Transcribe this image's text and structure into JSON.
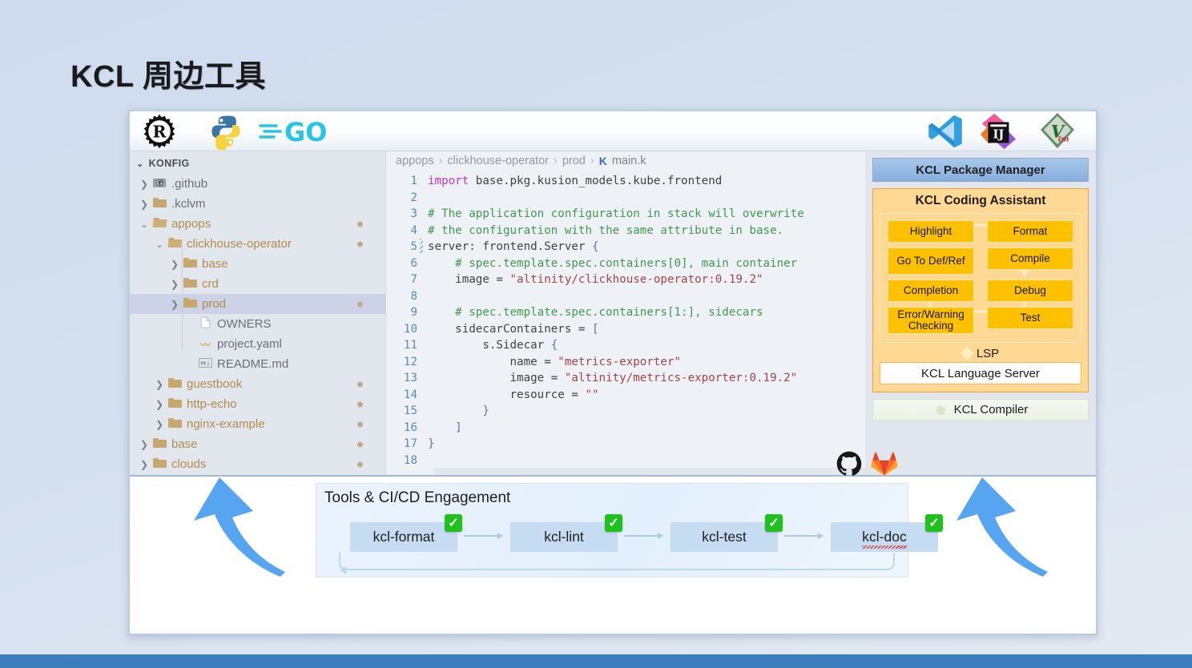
{
  "slide": {
    "title": "KCL 周边工具",
    "background_color": "#cfdcee",
    "accent_bar_color": "#3a7ebf"
  },
  "toolbar": {
    "left_logos": [
      {
        "name": "rust-logo",
        "label": "Rust"
      },
      {
        "name": "python-logo",
        "label": "Python"
      },
      {
        "name": "go-logo",
        "label": "GO"
      }
    ],
    "right_logos": [
      {
        "name": "vscode-logo",
        "label": "Visual Studio Code"
      },
      {
        "name": "intellij-idea-logo",
        "label": "IJ"
      },
      {
        "name": "vim-logo",
        "label": "Vim"
      }
    ]
  },
  "explorer": {
    "root_label": "KONFIG",
    "items": [
      {
        "label": ".github",
        "indent": 0,
        "icon": "github-folder-icon",
        "chevron": ">",
        "modified": false,
        "dot": false,
        "selected": false
      },
      {
        "label": ".kclvm",
        "indent": 0,
        "icon": "folder-icon",
        "chevron": ">",
        "modified": false,
        "dot": false,
        "selected": false
      },
      {
        "label": "appops",
        "indent": 0,
        "icon": "folder-open-icon",
        "chevron": "v",
        "modified": true,
        "dot": true,
        "selected": false
      },
      {
        "label": "clickhouse-operator",
        "indent": 1,
        "icon": "folder-open-icon",
        "chevron": "v",
        "modified": true,
        "dot": true,
        "selected": false
      },
      {
        "label": "base",
        "indent": 2,
        "icon": "folder-icon",
        "chevron": ">",
        "modified": true,
        "dot": false,
        "selected": false
      },
      {
        "label": "crd",
        "indent": 2,
        "icon": "folder-icon",
        "chevron": ">",
        "modified": true,
        "dot": false,
        "selected": false
      },
      {
        "label": "prod",
        "indent": 2,
        "icon": "folder-icon",
        "chevron": ">",
        "modified": true,
        "dot": true,
        "selected": true
      },
      {
        "label": "OWNERS",
        "indent": 3,
        "icon": "file-icon",
        "chevron": "",
        "modified": false,
        "dot": false,
        "selected": false
      },
      {
        "label": "project.yaml",
        "indent": 3,
        "icon": "yaml-file-icon",
        "chevron": "",
        "modified": false,
        "dot": false,
        "selected": false
      },
      {
        "label": "README.md",
        "indent": 3,
        "icon": "markdown-file-icon",
        "chevron": "",
        "modified": false,
        "dot": false,
        "selected": false
      },
      {
        "label": "guestbook",
        "indent": 1,
        "icon": "folder-icon",
        "chevron": ">",
        "modified": true,
        "dot": true,
        "selected": false
      },
      {
        "label": "http-echo",
        "indent": 1,
        "icon": "folder-icon",
        "chevron": ">",
        "modified": true,
        "dot": true,
        "selected": false
      },
      {
        "label": "nginx-example",
        "indent": 1,
        "icon": "folder-icon",
        "chevron": ">",
        "modified": true,
        "dot": true,
        "selected": false
      },
      {
        "label": "base",
        "indent": 0,
        "icon": "folder-icon",
        "chevron": ">",
        "modified": true,
        "dot": true,
        "selected": false
      },
      {
        "label": "clouds",
        "indent": 0,
        "icon": "folder-icon",
        "chevron": ">",
        "modified": true,
        "dot": true,
        "selected": false
      }
    ]
  },
  "editor": {
    "breadcrumb": [
      "appops",
      "clickhouse-operator",
      "prod"
    ],
    "file_icon_label": "K",
    "file_name": "main.k",
    "line_numbers": [
      1,
      2,
      3,
      4,
      5,
      6,
      7,
      8,
      9,
      10,
      11,
      12,
      13,
      14,
      15,
      16,
      17,
      18
    ],
    "change_marker_line": 5,
    "lines": [
      {
        "n": 1,
        "tokens": [
          {
            "t": "kw",
            "v": "import "
          },
          {
            "t": "pl",
            "v": "base.pkg.kusion_models.kube.frontend"
          }
        ]
      },
      {
        "n": 2,
        "tokens": []
      },
      {
        "n": 3,
        "tokens": [
          {
            "t": "cmt",
            "v": "# The application configuration in stack will overwrite"
          }
        ]
      },
      {
        "n": 4,
        "tokens": [
          {
            "t": "cmt",
            "v": "# the configuration with the same attribute in base."
          }
        ]
      },
      {
        "n": 5,
        "tokens": [
          {
            "t": "pl",
            "v": "server: frontend.Server "
          },
          {
            "t": "br",
            "v": "{"
          }
        ]
      },
      {
        "n": 6,
        "tokens": [
          {
            "t": "ind-g",
            "v": "    "
          },
          {
            "t": "cmt",
            "v": "# spec.template.spec.containers[0], main container"
          }
        ]
      },
      {
        "n": 7,
        "tokens": [
          {
            "t": "ind-g",
            "v": "    "
          },
          {
            "t": "pl",
            "v": "image = "
          },
          {
            "t": "str",
            "v": "\"altinity/clickhouse-operator:0.19.2\""
          }
        ]
      },
      {
        "n": 8,
        "tokens": []
      },
      {
        "n": 9,
        "tokens": [
          {
            "t": "ind-g",
            "v": "    "
          },
          {
            "t": "cmt",
            "v": "# spec.template.spec.containers[1:], sidecars"
          }
        ]
      },
      {
        "n": 10,
        "tokens": [
          {
            "t": "ind-g",
            "v": "    "
          },
          {
            "t": "pl",
            "v": "sidecarContainers = "
          },
          {
            "t": "br",
            "v": "["
          }
        ]
      },
      {
        "n": 11,
        "tokens": [
          {
            "t": "ind-g",
            "v": "        "
          },
          {
            "t": "pl",
            "v": "s.Sidecar "
          },
          {
            "t": "br",
            "v": "{"
          }
        ]
      },
      {
        "n": 12,
        "tokens": [
          {
            "t": "ind-g",
            "v": "            "
          },
          {
            "t": "pl",
            "v": "name = "
          },
          {
            "t": "str",
            "v": "\"metrics-exporter\""
          }
        ]
      },
      {
        "n": 13,
        "tokens": [
          {
            "t": "ind-g",
            "v": "            "
          },
          {
            "t": "pl",
            "v": "image = "
          },
          {
            "t": "str",
            "v": "\"altinity/metrics-exporter:0.19.2\""
          }
        ]
      },
      {
        "n": 14,
        "tokens": [
          {
            "t": "ind-g",
            "v": "            "
          },
          {
            "t": "pl",
            "v": "resource = "
          },
          {
            "t": "str",
            "v": "\"\""
          }
        ]
      },
      {
        "n": 15,
        "tokens": [
          {
            "t": "ind-g",
            "v": "        "
          },
          {
            "t": "br",
            "v": "}"
          }
        ]
      },
      {
        "n": 16,
        "tokens": [
          {
            "t": "ind-g",
            "v": "    "
          },
          {
            "t": "br",
            "v": "]"
          }
        ]
      },
      {
        "n": 17,
        "tokens": [
          {
            "t": "br",
            "v": "}"
          }
        ]
      },
      {
        "n": 18,
        "tokens": []
      }
    ]
  },
  "assistant_panel": {
    "package_manager_label": "KCL Package Manager",
    "package_manager_color": "#8fb3de",
    "title": "KCL Coding Assistant",
    "accent_color": "#ffc000",
    "features": [
      {
        "label": "Highlight"
      },
      {
        "label": "Format"
      },
      {
        "label": "Go To Def/Ref"
      },
      {
        "label": "Compile"
      },
      {
        "label": "Completion"
      },
      {
        "label": "Debug"
      },
      {
        "label": "Error/Warning Checking"
      },
      {
        "label": "Test"
      }
    ],
    "lsp_label": "LSP",
    "language_server_label": "KCL Language Server",
    "compiler_label": "KCL Compiler"
  },
  "cicd": {
    "title": "Tools & CI/CD Engagement",
    "stages": [
      {
        "label": "kcl-format",
        "status": "check",
        "squiggle": false
      },
      {
        "label": "kcl-lint",
        "status": "check",
        "squiggle": false
      },
      {
        "label": "kcl-test",
        "status": "check",
        "squiggle": false
      },
      {
        "label": "kcl-doc",
        "status": "check",
        "squiggle": true
      }
    ],
    "check_color": "#1fc11f",
    "check_glyph": "✓",
    "vendors": [
      {
        "name": "github-logo",
        "label": "GitHub"
      },
      {
        "name": "gitlab-logo",
        "label": "GitLab"
      }
    ]
  },
  "arrows": [
    {
      "name": "arrow-up-left",
      "color": "#57a5f0"
    },
    {
      "name": "arrow-down-left",
      "color": "#57a5f0"
    }
  ]
}
